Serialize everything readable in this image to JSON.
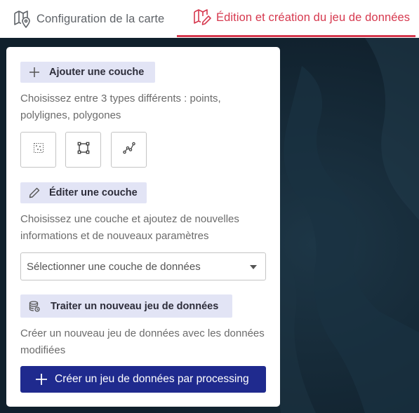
{
  "tabs": {
    "config_label": "Configuration de la carte",
    "edit_label": "Édition et création du jeu de données"
  },
  "panel": {
    "add_layer": {
      "label": "Ajouter une couche",
      "description": "Choisissez entre 3 types différents : points, polylignes, polygones",
      "types": [
        "points",
        "polygon",
        "polyline"
      ]
    },
    "edit_layer": {
      "label": "Éditer une couche",
      "description": "Choisissez une couche et ajoutez de nouvelles informations et de nouveaux paramètres",
      "select_placeholder": "Sélectionner une couche de données"
    },
    "process": {
      "label": "Traiter un nouveau jeu de données",
      "description": "Créer un nouveau jeu de données avec les données modifiées",
      "create_button": "Créer un jeu de données par processing"
    }
  },
  "colors": {
    "accent": "#d6384e",
    "primary": "#1f2a8e",
    "section_bg": "#e2e4f5",
    "map_bg": "#162a38"
  }
}
